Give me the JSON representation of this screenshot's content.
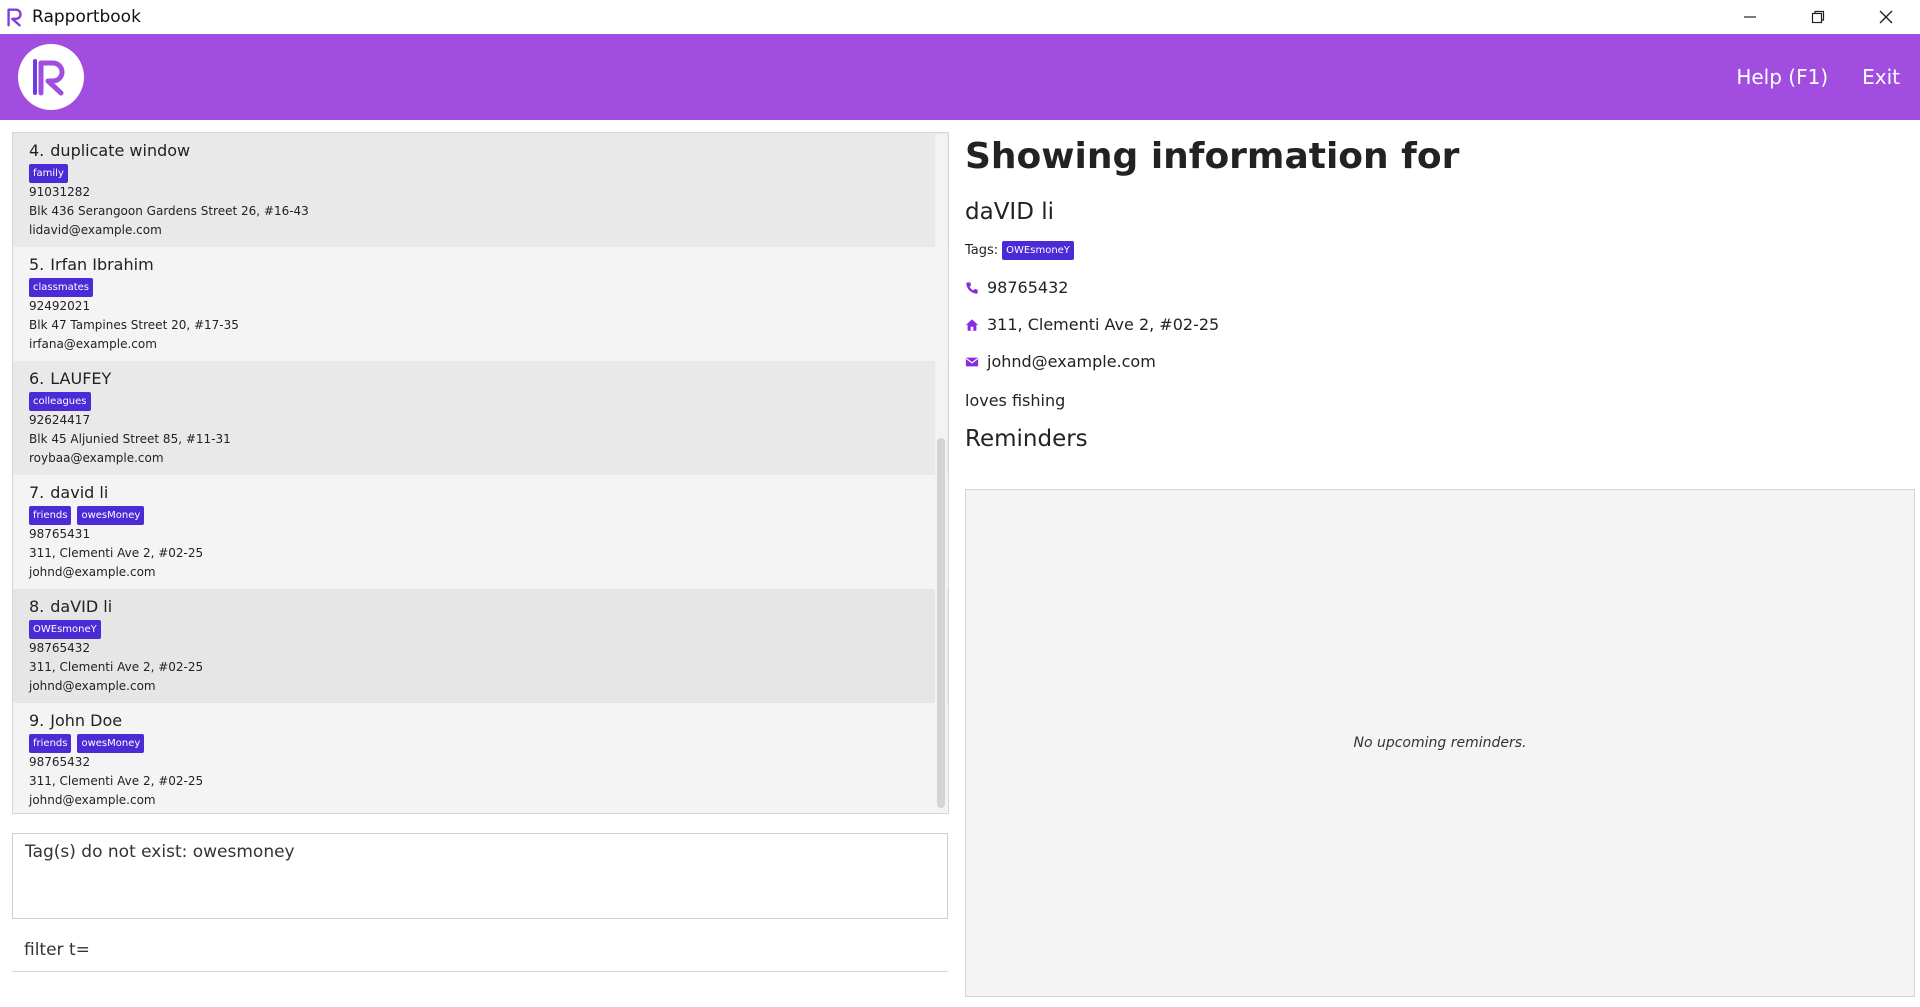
{
  "window": {
    "title": "Rapportbook",
    "controls": [
      "minimize-icon",
      "restore-icon",
      "close-icon"
    ]
  },
  "header": {
    "menu": [
      {
        "label": "Help (F1)"
      },
      {
        "label": "Exit"
      }
    ],
    "colors": {
      "header_bg": "#a14de0",
      "tag_bg": "#4a2bd6"
    }
  },
  "list": {
    "persons": [
      {
        "index": "4.",
        "name": "duplicate window",
        "tags": [
          "family"
        ],
        "phone": "91031282",
        "address": "Blk 436 Serangoon Gardens Street 26, #16-43",
        "email": "lidavid@example.com"
      },
      {
        "index": "5.",
        "name": "Irfan Ibrahim",
        "tags": [
          "classmates"
        ],
        "phone": "92492021",
        "address": "Blk 47 Tampines Street 20, #17-35",
        "email": "irfana@example.com"
      },
      {
        "index": "6.",
        "name": "LAUFEY",
        "tags": [
          "colleagues"
        ],
        "phone": "92624417",
        "address": "Blk 45 Aljunied Street 85, #11-31",
        "email": "roybaa@example.com"
      },
      {
        "index": "7.",
        "name": "david li",
        "tags": [
          "friends",
          "owesMoney"
        ],
        "phone": "98765431",
        "address": "311, Clementi Ave 2, #02-25",
        "email": "johnd@example.com"
      },
      {
        "index": "8.",
        "name": "daVID li",
        "tags": [
          "OWEsmoneY"
        ],
        "phone": "98765432",
        "address": "311, Clementi Ave 2, #02-25",
        "email": "johnd@example.com"
      },
      {
        "index": "9.",
        "name": "John Doe",
        "tags": [
          "friends",
          "owesMoney"
        ],
        "phone": "98765432",
        "address": "311, Clementi Ave 2, #02-25",
        "email": "johnd@example.com"
      }
    ]
  },
  "result": {
    "text": "Tag(s) do not exist: owesmoney"
  },
  "command": {
    "value": "filter t="
  },
  "detail": {
    "heading": "Showing information for",
    "name": "daVID li",
    "tags_label": "Tags:",
    "tags": [
      "OWEsmoneY"
    ],
    "phone": "98765432",
    "address": "311, Clementi Ave 2, #02-25",
    "email": "johnd@example.com",
    "note": "loves fishing",
    "reminders_title": "Reminders",
    "reminders_empty": "No upcoming reminders."
  }
}
